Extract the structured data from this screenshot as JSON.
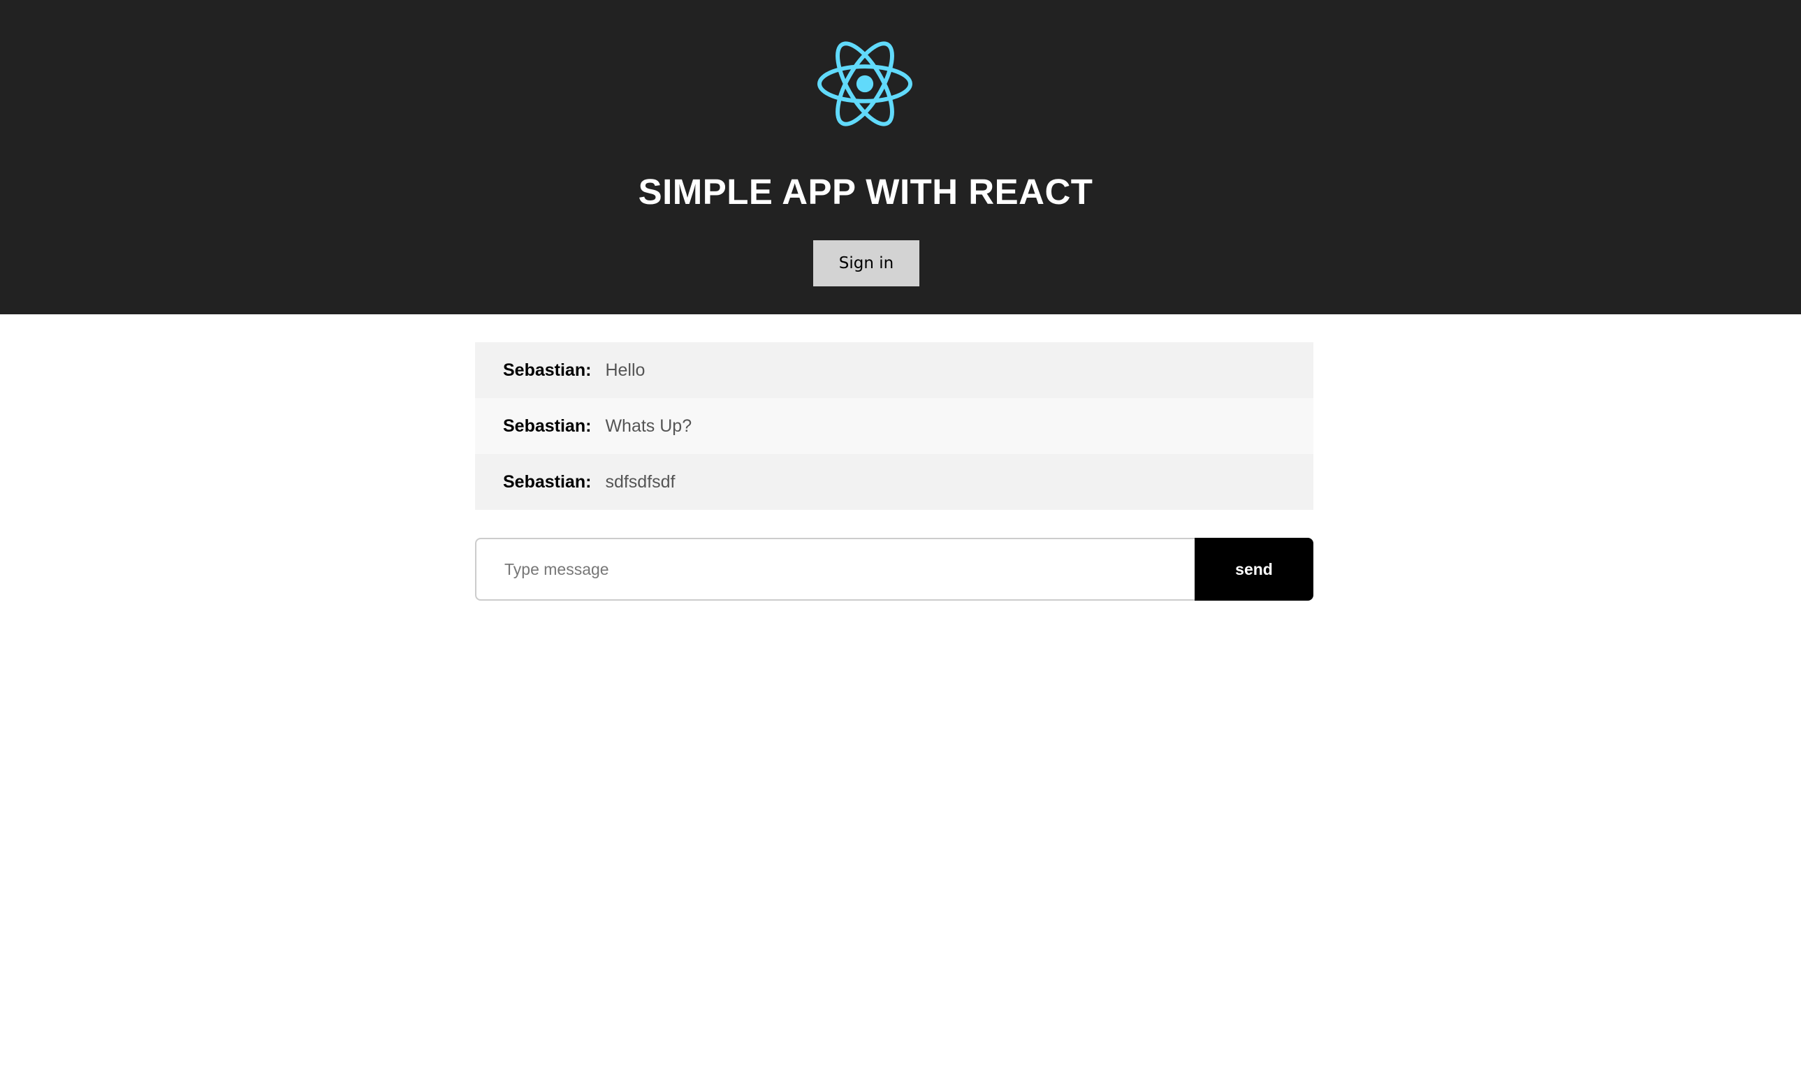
{
  "header": {
    "logo_icon": "react-logo-icon",
    "title": "SIMPLE APP WITH REACT",
    "signin_label": "Sign in"
  },
  "colors": {
    "header_bg": "#222222",
    "logo": "#61dafb",
    "signin_bg": "#d3d3d3",
    "send_bg": "#000000"
  },
  "messages": [
    {
      "author": "Sebastian:",
      "text": "Hello"
    },
    {
      "author": "Sebastian:",
      "text": "Whats Up?"
    },
    {
      "author": "Sebastian:",
      "text": "sdfsdfsdf"
    }
  ],
  "composer": {
    "value": "",
    "placeholder": "Type message",
    "send_label": "send"
  }
}
